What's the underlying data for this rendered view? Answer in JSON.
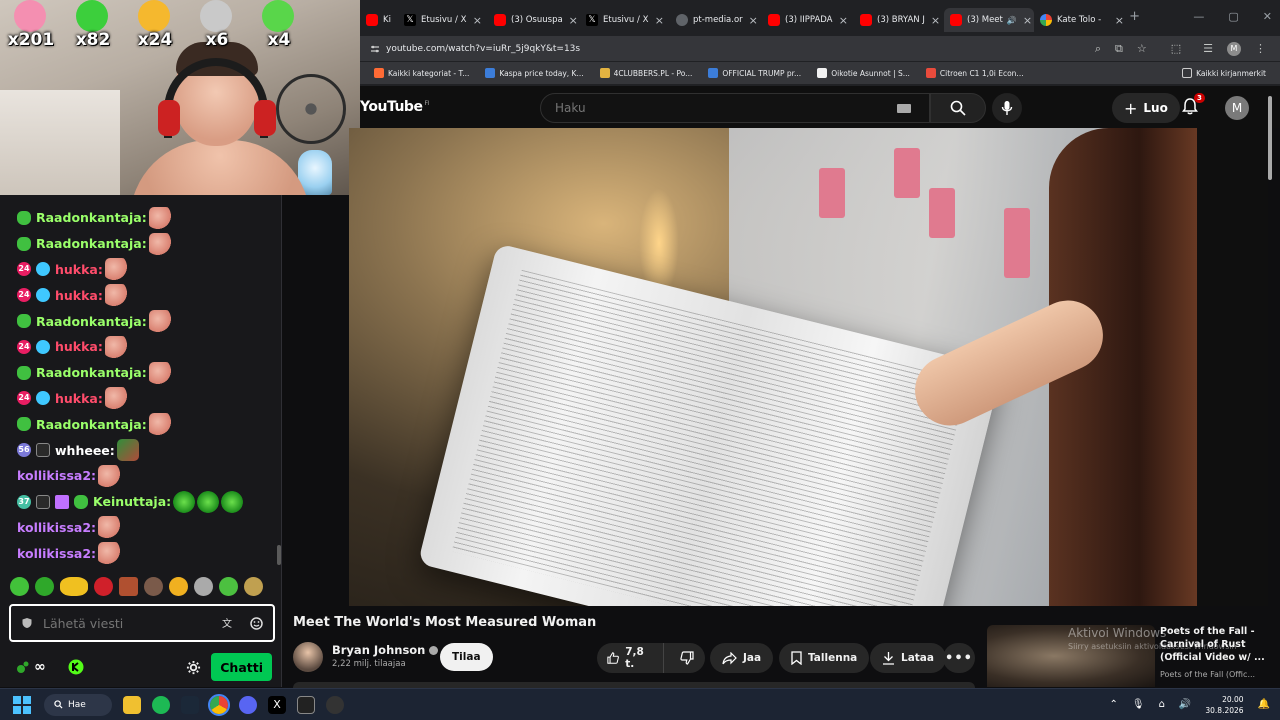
{
  "overlay": {
    "emote_counts": [
      "x201",
      "x82",
      "x24",
      "x6",
      "x4"
    ],
    "emote_icons": [
      "patrick-icon",
      "frog-icon",
      "shushing-face-icon",
      "pale-face-icon",
      "frog-icon"
    ]
  },
  "chat": {
    "messages": [
      {
        "badges": [
          "frog"
        ],
        "user": "Raadonkantaja:",
        "color": "#9aff6a",
        "emotes": [
          "hand"
        ]
      },
      {
        "badges": [
          "frog"
        ],
        "user": "Raadonkantaja:",
        "color": "#9aff6a",
        "emotes": [
          "hand"
        ]
      },
      {
        "badges": [
          "24",
          "blue"
        ],
        "user": "hukka:",
        "color": "#ff4c6b",
        "emotes": [
          "hand"
        ]
      },
      {
        "badges": [
          "24",
          "blue"
        ],
        "user": "hukka:",
        "color": "#ff4c6b",
        "emotes": [
          "hand"
        ]
      },
      {
        "badges": [
          "frog"
        ],
        "user": "Raadonkantaja:",
        "color": "#9aff6a",
        "emotes": [
          "hand"
        ]
      },
      {
        "badges": [
          "24",
          "blue"
        ],
        "user": "hukka:",
        "color": "#ff4c6b",
        "emotes": [
          "hand"
        ]
      },
      {
        "badges": [
          "frog"
        ],
        "user": "Raadonkantaja:",
        "color": "#9aff6a",
        "emotes": [
          "hand"
        ]
      },
      {
        "badges": [
          "24",
          "blue"
        ],
        "user": "hukka:",
        "color": "#ff4c6b",
        "emotes": [
          "hand"
        ]
      },
      {
        "badges": [
          "frog"
        ],
        "user": "Raadonkantaja:",
        "color": "#9aff6a",
        "emotes": [
          "hand"
        ]
      },
      {
        "badges": [
          "56",
          "face"
        ],
        "user": "whheee:",
        "color": "#ffffff",
        "emotes": [
          "money"
        ]
      },
      {
        "badges": [],
        "user": "kollikissa2:",
        "color": "#c77dff",
        "emotes": [
          "hand"
        ]
      },
      {
        "badges": [
          "37",
          "face",
          "gift",
          "frog"
        ],
        "user": "Keinuttaja:",
        "color": "#9aff6a",
        "emotes": [
          "frog",
          "frog",
          "frog"
        ]
      },
      {
        "badges": [],
        "user": "kollikissa2:",
        "color": "#c77dff",
        "emotes": [
          "hand"
        ]
      },
      {
        "badges": [],
        "user": "kollikissa2:",
        "color": "#c77dff",
        "emotes": [
          "hand"
        ]
      }
    ],
    "input_placeholder": "Lähetä viesti",
    "points_label": "∞",
    "chat_button": "Chatti"
  },
  "browser": {
    "tabs": [
      {
        "label": "Ki",
        "favicon": "yt",
        "active": false
      },
      {
        "label": "Etusivu / X",
        "favicon": "x",
        "active": false
      },
      {
        "label": "(3) Osuuspa",
        "favicon": "yt",
        "active": false
      },
      {
        "label": "Etusivu / X",
        "favicon": "x",
        "active": false
      },
      {
        "label": "pt-media.or",
        "favicon": "pt",
        "active": false
      },
      {
        "label": "(3) IIPPADA",
        "favicon": "yt",
        "active": false
      },
      {
        "label": "(3) BRYAN J",
        "favicon": "yt",
        "active": false
      },
      {
        "label": "(3) Meet",
        "favicon": "yt",
        "active": true
      },
      {
        "label": "Kate Tolo - ",
        "favicon": "g",
        "active": false
      }
    ],
    "url": "youtube.com/watch?v=iuRr_5j9qkY&t=13s",
    "bookmarks": [
      {
        "label": "Kaikki kategoriat - T...",
        "color": "#ff6b35"
      },
      {
        "label": "Kaspa price today, K...",
        "color": "#3c7dd9"
      },
      {
        "label": "4CLUBBERS.PL - Po...",
        "color": "#e3b341"
      },
      {
        "label": "OFFICIAL TRUMP pr...",
        "color": "#3c7dd9"
      },
      {
        "label": "Oikotie Asunnot | S...",
        "color": "#f1f1f1"
      },
      {
        "label": "Citroen C1 1,0i Econ...",
        "color": "#e94b3c"
      }
    ],
    "all_bookmarks": "Kaikki kirjanmerkit"
  },
  "youtube": {
    "logo": "YouTube",
    "region": "FI",
    "search_placeholder": "Haku",
    "create_label": "Luo",
    "notification_count": "3",
    "avatar_letter": "M",
    "video_title": "Meet The World's Most Measured Woman",
    "channel_name": "Bryan Johnson",
    "subscribers": "2,22 milj. tilaajaa",
    "subscribe": "Tilaa",
    "likes": "7,8 t.",
    "share": "Jaa",
    "save": "Tallenna",
    "download": "Lataa",
    "recommended": {
      "title": "Poets of the Fall - Carnival of Rust (Official Video w/ ...",
      "channel": "Poets of the Fall (Offic..."
    }
  },
  "windows": {
    "activate_title": "Aktivoi Windows",
    "activate_sub": "Siirry asetuksiin aktivoidaksesi Windowsin",
    "search": "Hae",
    "time": "20.00",
    "date": "30.8.2026"
  },
  "colors": {
    "chat_bg": "#18181b",
    "yt_bg": "#0f0f0f",
    "chat_button": "#00c853",
    "taskbar": "#1c2433"
  }
}
